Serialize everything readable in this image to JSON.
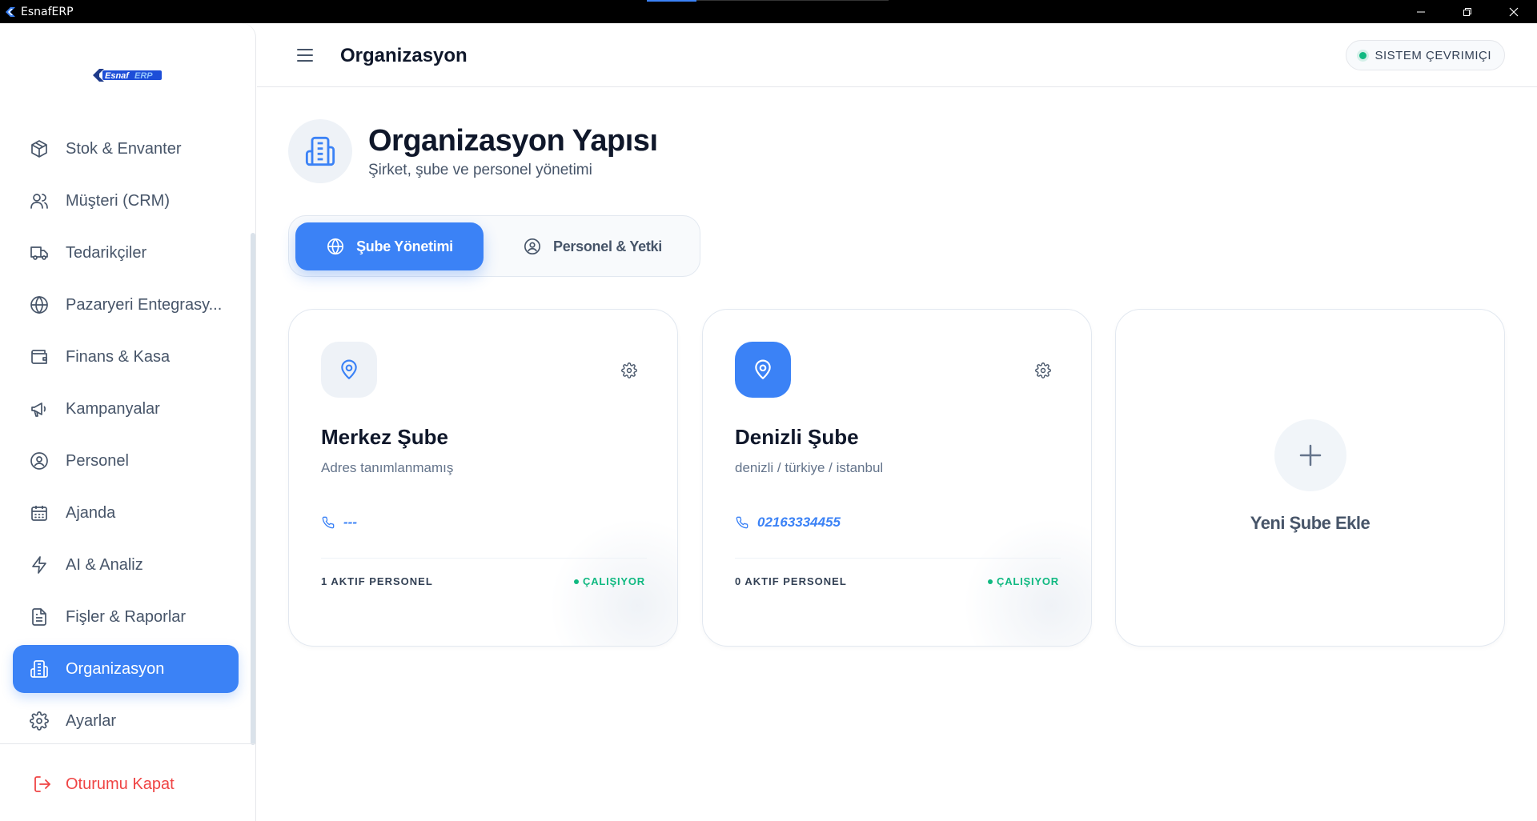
{
  "window": {
    "title": "EsnafERP"
  },
  "brand": {
    "logo_text_a": "Esnaf",
    "logo_text_b": "ERP"
  },
  "sidebar": {
    "items": [
      {
        "label": "Stok & Envanter",
        "icon": "box-icon"
      },
      {
        "label": "Müşteri (CRM)",
        "icon": "users-icon"
      },
      {
        "label": "Tedarikçiler",
        "icon": "truck-icon"
      },
      {
        "label": "Pazaryeri Entegrasy...",
        "icon": "globe-icon"
      },
      {
        "label": "Finans & Kasa",
        "icon": "wallet-icon"
      },
      {
        "label": "Kampanyalar",
        "icon": "megaphone-icon"
      },
      {
        "label": "Personel",
        "icon": "user-circle-icon"
      },
      {
        "label": "Ajanda",
        "icon": "calendar-icon"
      },
      {
        "label": "AI & Analiz",
        "icon": "zap-icon"
      },
      {
        "label": "Fişler & Raporlar",
        "icon": "file-text-icon"
      },
      {
        "label": "Organizasyon",
        "icon": "building-icon",
        "active": true
      },
      {
        "label": "Ayarlar",
        "icon": "gear-icon"
      }
    ],
    "logout_label": "Oturumu Kapat"
  },
  "header": {
    "title": "Organizasyon",
    "status": "SISTEM ÇEVRIMIÇI"
  },
  "page": {
    "title": "Organizasyon Yapısı",
    "subtitle": "Şirket, şube ve personel yönetimi"
  },
  "tabs": [
    {
      "label": "Şube Yönetimi",
      "active": true
    },
    {
      "label": "Personel & Yetki",
      "active": false
    }
  ],
  "branches": [
    {
      "name": "Merkez Şube",
      "address": "Adres tanımlanmamış",
      "phone": "---",
      "staff": "1 AKTIF PERSONEL",
      "status": "ÇALIŞIYOR"
    },
    {
      "name": "Denizli Şube",
      "address": "denizli / türkiye / istanbul",
      "phone": "02163334455",
      "staff": "0 AKTIF PERSONEL",
      "status": "ÇALIŞIYOR"
    }
  ],
  "add_branch": {
    "label": "Yeni Şube Ekle"
  },
  "colors": {
    "accent": "#3b82f6",
    "success": "#10b981",
    "danger": "#ef4444"
  }
}
